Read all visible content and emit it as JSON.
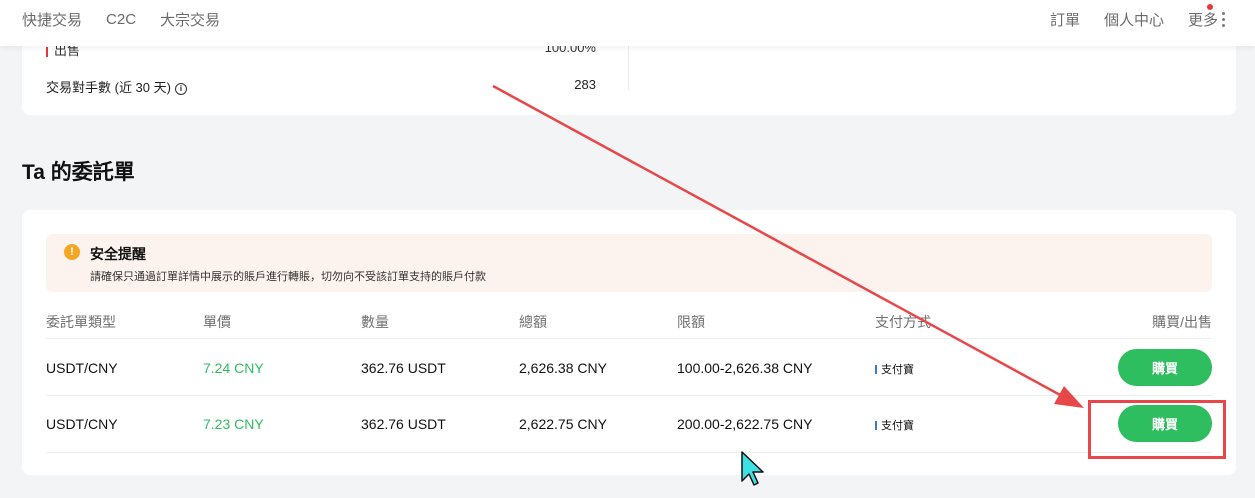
{
  "nav": {
    "left": [
      "快捷交易",
      "C2C",
      "大宗交易"
    ],
    "right": {
      "orders": "訂單",
      "profile": "個人中心",
      "more": "更多"
    }
  },
  "stats": {
    "sell_label": "出售",
    "sell_value": "100.00%",
    "counterparties_label": "交易對手數 (近 30 天)",
    "counterparties_value": "283"
  },
  "section_title": "Ta 的委託單",
  "notice": {
    "title": "安全提醒",
    "text": "請確保只通過訂單詳情中展示的賬戶進行轉賬，切勿向不受該訂單支持的賬戶付款"
  },
  "table": {
    "headers": [
      "委託單類型",
      "單價",
      "數量",
      "總額",
      "限額",
      "支付方式",
      "購買/出售"
    ],
    "rows": [
      {
        "pair": "USDT/CNY",
        "price": "7.24 CNY",
        "qty": "362.76 USDT",
        "total": "2,626.38 CNY",
        "limit": "100.00-2,626.38 CNY",
        "pay": "支付寶",
        "action": "購買"
      },
      {
        "pair": "USDT/CNY",
        "price": "7.23 CNY",
        "qty": "362.76 USDT",
        "total": "2,622.75 CNY",
        "limit": "200.00-2,622.75 CNY",
        "pay": "支付寶",
        "action": "購買"
      }
    ]
  },
  "colors": {
    "accent_green": "#2ebd5f",
    "annotation_red": "#e8474a",
    "warning_orange": "#f5a524"
  }
}
